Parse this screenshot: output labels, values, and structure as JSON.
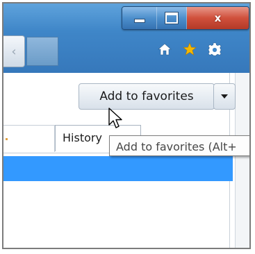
{
  "window": {
    "caption_buttons": {
      "minimize_icon": "minimize-icon",
      "maximize_icon": "maximize-icon",
      "close_label": "x"
    }
  },
  "toolbar": {
    "back_arrow": "‹",
    "icons": [
      "home-icon",
      "star-icon",
      "gear-icon"
    ],
    "star_color": "#f5b800"
  },
  "favorites": {
    "add_button_label": "Add to favorites",
    "dropdown_icon": "chevron-down-icon",
    "tooltip_text": "Add to favorites (Alt+"
  },
  "tabs": {
    "history_label": "History"
  },
  "colors": {
    "titlebar": "#3f86c8",
    "close_button": "#c94532",
    "selection": "#3399ff"
  }
}
